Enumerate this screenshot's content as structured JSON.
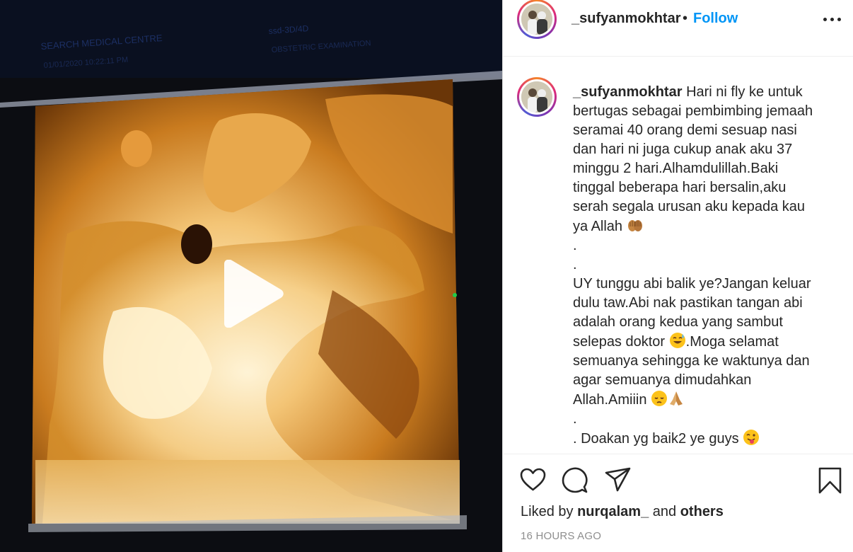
{
  "post": {
    "username": "_sufyanmokhtar",
    "separator": "•",
    "follow_label": "Follow",
    "more_icon": "more-options-icon",
    "caption_lines": [
      "Hari ni fly ke untuk",
      "bertugas sebagai pembimbing jemaah",
      "seramai 40 orang demi sesuap nasi",
      "dan hari ni juga cukup anak aku 37",
      "minggu 2 hari.Alhamdulillah.Baki",
      "tinggal beberapa hari bersalin,aku",
      "serah segala urusan aku kepada kau",
      "ya Allah",
      ".",
      ".",
      "UY tunggu abi balik ye?Jangan keluar",
      "dulu taw.Abi nak pastikan tangan abi",
      "adalah orang kedua yang sambut",
      "selepas doktor",
      ".Moga selamat",
      "semuanya sehingga ke waktunya dan",
      "agar semuanya dimudahkan",
      "Allah.Amiiin",
      ".",
      ". Doakan yg baik2 ye guys"
    ],
    "emojis": {
      "open_hands": "open-hands-emoji",
      "sweat_smile": "sweat-smile-emoji",
      "pensive": "pensive-emoji",
      "pray": "folded-hands-emoji",
      "wink_tongue": "winking-tongue-emoji"
    },
    "liked_prefix": "Liked by",
    "liked_user": "nurqalam_",
    "liked_and": "and",
    "liked_others": "others",
    "timestamp": "16 HOURS AGO"
  },
  "media": {
    "type": "video",
    "play_icon": "play-icon",
    "screen_text_left_1": "SEARCH MEDICAL CENTRE",
    "screen_text_left_2": "01/01/2020 10:22:11 PM",
    "screen_text_right_1": "ssd-3D/4D",
    "screen_text_right_2": "OBSTETRIC EXAMINATION"
  },
  "colors": {
    "accent": "#0095f6",
    "text": "#262626",
    "muted": "#8e8e8e"
  }
}
